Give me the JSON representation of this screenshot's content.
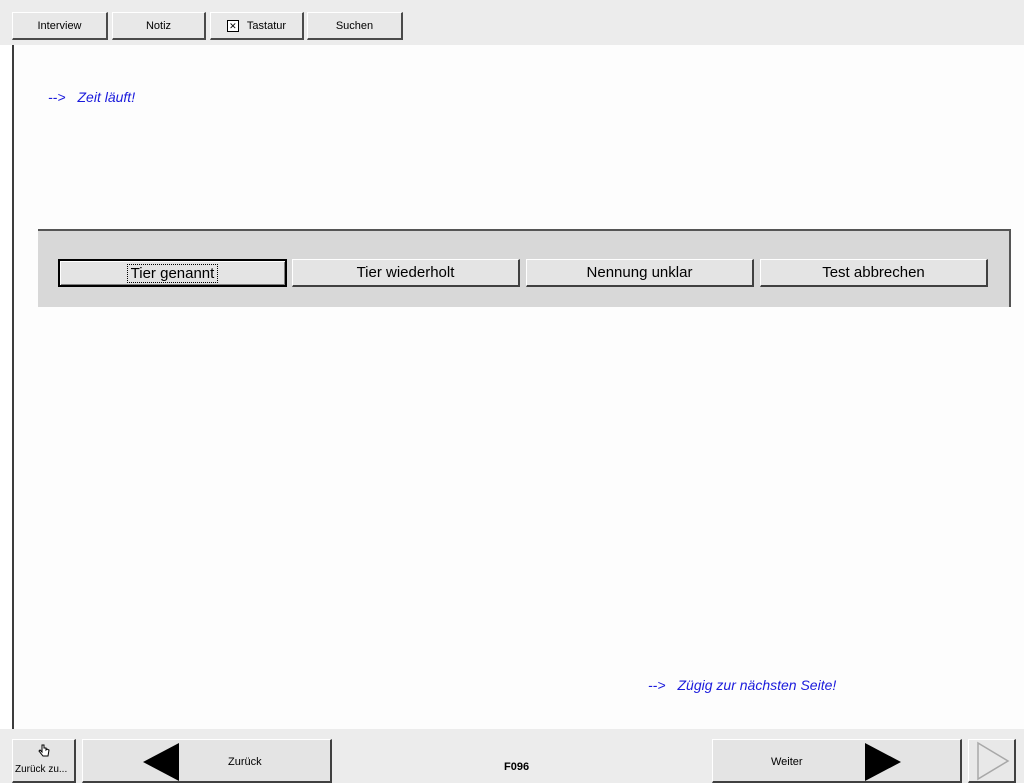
{
  "toolbar": {
    "interview": "Interview",
    "notiz": "Notiz",
    "tastatur": "Tastatur",
    "tastatur_checked": true,
    "suchen": "Suchen"
  },
  "content": {
    "hint_top_arrow": "-->",
    "hint_top": "Zeit läuft!",
    "hint_bottom_arrow": "-->",
    "hint_bottom": "Zügig zur nächsten Seite!"
  },
  "answers": [
    {
      "label": "Tier genannt",
      "focused": true
    },
    {
      "label": "Tier wiederholt"
    },
    {
      "label": "Nennung unklar"
    },
    {
      "label": "Test abbrechen"
    }
  ],
  "navigation": {
    "back_to_label": "Zurück zu...",
    "back_label": "Zurück",
    "page_code": "F096",
    "next_label": "Weiter"
  },
  "icons": {
    "back_to": "hand-pointer-icon",
    "back": "triangle-left-icon",
    "next": "triangle-right-icon",
    "forward_disabled": "triangle-right-outline-icon"
  }
}
